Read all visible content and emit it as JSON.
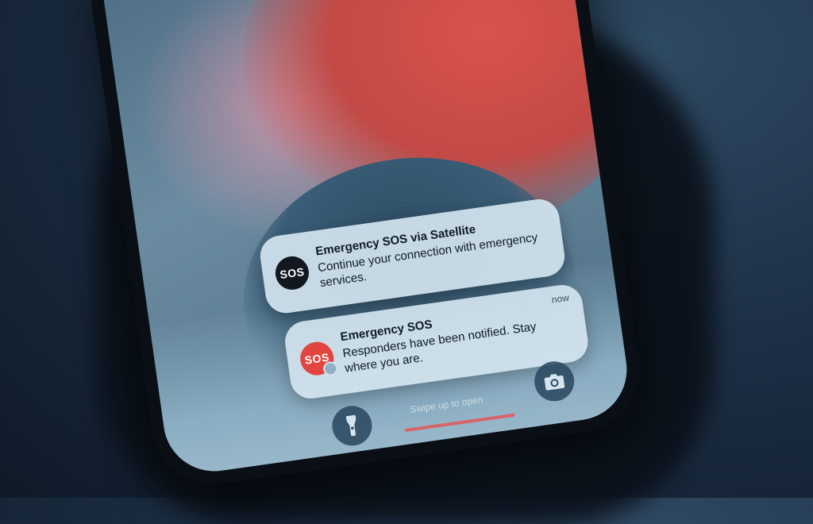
{
  "notifications": [
    {
      "app_icon_label": "SOS",
      "app_icon_name": "sos-satellite-icon",
      "title": "Emergency SOS via Satellite",
      "body": "Continue your connection with emergency services."
    },
    {
      "app_icon_label": "SOS",
      "app_icon_name": "sos-icon",
      "title": "Emergency SOS",
      "body": "Responders have been notified. Stay where you are.",
      "time": "now"
    }
  ],
  "lockscreen": {
    "hint": "Swipe up to open",
    "flashlight_icon": "flashlight-icon",
    "camera_icon": "camera-icon"
  },
  "colors": {
    "sos_red": "#e2453f",
    "sos_dark": "#111820",
    "background": "#1d3046"
  }
}
